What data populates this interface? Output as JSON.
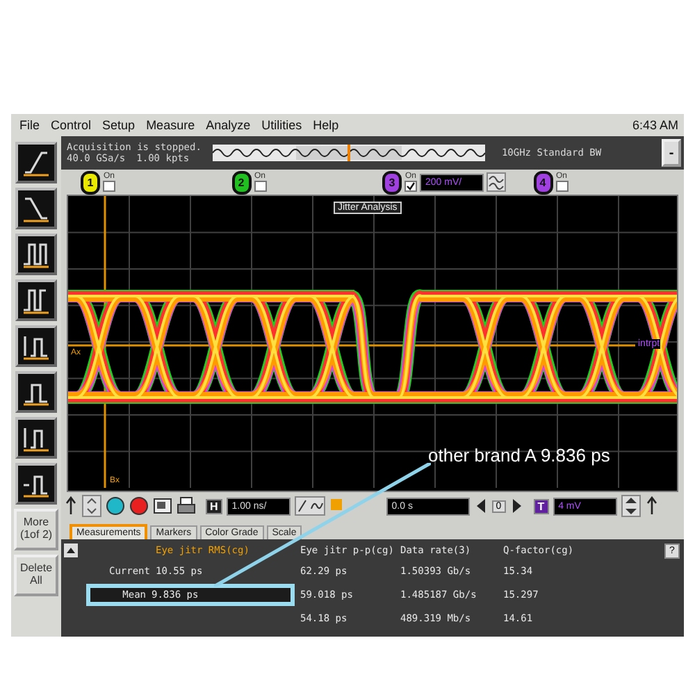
{
  "menu_bar": {
    "items": [
      "File",
      "Control",
      "Setup",
      "Measure",
      "Analyze",
      "Utilities",
      "Help"
    ],
    "clock": "6:43 AM"
  },
  "status": {
    "acquisition": "Acquisition is stopped.",
    "sample_rate": "40.0 GSa/s",
    "memory_depth": "1.00 kpts",
    "bandwidth": "10GHz Standard BW",
    "minimize_button": "-"
  },
  "channels": [
    {
      "number": "1",
      "label": "On",
      "color": "#e8e800",
      "on": false
    },
    {
      "number": "2",
      "label": "On",
      "color": "#20c020",
      "on": false
    },
    {
      "number": "3",
      "label": "On",
      "color": "#a040e0",
      "on": true,
      "scale": "200 mV/"
    },
    {
      "number": "4",
      "label": "On",
      "color": "#a040e0",
      "on": false
    }
  ],
  "sidebar": {
    "buttons": [
      "More (1of 2)",
      "Delete All"
    ]
  },
  "graph": {
    "title": "Jitter Analysis",
    "marker_a": "Ax",
    "marker_b": "Bx",
    "level_label": "intrpt"
  },
  "horizontal": {
    "label": "H",
    "scale": "1.00 ns/",
    "position": "0.0 s",
    "zoom_value": "0"
  },
  "trigger": {
    "label": "T",
    "level": "4 mV"
  },
  "tabs": [
    {
      "label": "Measurements",
      "selected": true
    },
    {
      "label": "Markers",
      "selected": false
    },
    {
      "label": "Color Grade",
      "selected": false
    },
    {
      "label": "Scale",
      "selected": false
    }
  ],
  "measurements": {
    "columns": [
      "Eye jitr RMS(cg)",
      "Eye jitr p-p(cg)",
      "Data rate(3)",
      "Q-factor(cg)"
    ],
    "help": "?",
    "rows": [
      {
        "label": "Current",
        "eye_jitter_rms": "10.55 ps",
        "eye_jitter_pp": "62.29 ps",
        "data_rate": "1.50393 Gb/s",
        "q_factor": "15.34",
        "highlighted": false
      },
      {
        "label": "Mean",
        "eye_jitter_rms": "9.836 ps",
        "eye_jitter_pp": "59.018 ps",
        "data_rate": "1.485187 Gb/s",
        "q_factor": "15.297",
        "highlighted": true
      },
      {
        "eye_jitter_pp": "54.18 ps",
        "data_rate": "489.319 Mb/s",
        "q_factor": "14.61",
        "highlighted": false
      }
    ]
  },
  "annotation": {
    "text": "other brand A  9.836 ps"
  }
}
